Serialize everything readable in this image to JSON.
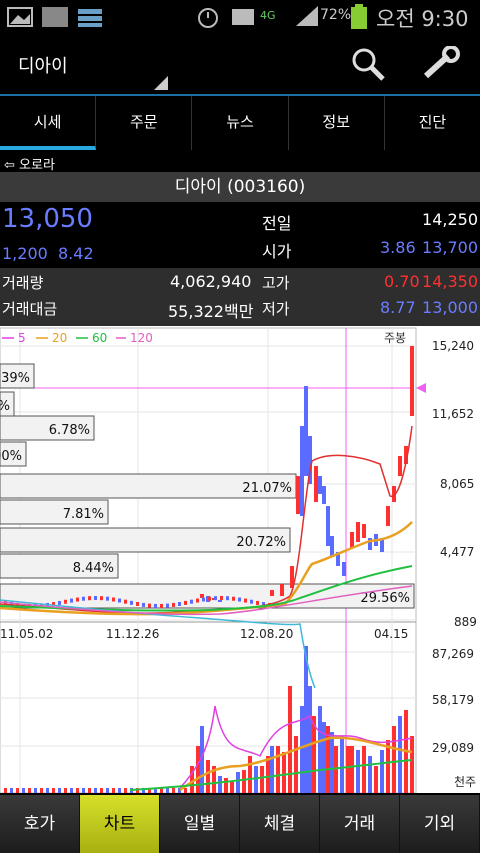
{
  "status_bar": {
    "network": "4G",
    "battery": "72%",
    "time": "오전 9:30"
  },
  "header": {
    "title": "디아이"
  },
  "tabs": [
    {
      "label": "시세",
      "active": true
    },
    {
      "label": "주문",
      "active": false
    },
    {
      "label": "뉴스",
      "active": false
    },
    {
      "label": "정보",
      "active": false
    },
    {
      "label": "진단",
      "active": false
    }
  ],
  "back": {
    "label": "⇦ 오로라"
  },
  "stock": {
    "title": "디아이 (003160)"
  },
  "quote": {
    "price": "13,050",
    "change": "1,200",
    "change_pct": "8.42",
    "prev_label": "전일",
    "prev_value": "14,250",
    "open_label": "시가",
    "open_pct": "3.86",
    "open_value": "13,700",
    "volume_label": "거래량",
    "volume_value": "4,062,940",
    "high_label": "고가",
    "high_pct": "0.70",
    "high_value": "14,350",
    "amount_label": "거래대금",
    "amount_value": "55,322백만",
    "low_label": "저가",
    "low_pct": "8.77",
    "low_value": "13,000"
  },
  "chart": {
    "legend": [
      {
        "label": "5",
        "color": "#e040e0"
      },
      {
        "label": "20",
        "color": "#e8a020"
      },
      {
        "label": "60",
        "color": "#20c040"
      },
      {
        "label": "120",
        "color": "#e060c0"
      }
    ],
    "period": "주봉",
    "price_ticks": [
      "15,240",
      "11,652",
      "8,065",
      "4,477",
      "889"
    ],
    "volume_ticks": [
      "87,269",
      "58,179",
      "29,089",
      "천주"
    ],
    "date_ticks": [
      "11.05.02",
      "11.12.26",
      "12.08.20",
      "04.15"
    ],
    "profile_labels": [
      "39%",
      "%",
      "6.78%",
      "00%",
      "21.07%",
      "7.81%",
      "20.72%",
      "8.44%",
      "29.56%"
    ]
  },
  "bottom_nav": [
    {
      "label": "호가",
      "active": false
    },
    {
      "label": "차트",
      "active": true
    },
    {
      "label": "일별",
      "active": false
    },
    {
      "label": "체결",
      "active": false
    },
    {
      "label": "거래",
      "active": false
    },
    {
      "label": "기외",
      "active": false
    }
  ],
  "colors": {
    "up": "#ff3030",
    "down": "#5a6cff",
    "accent": "#29a9e1"
  }
}
